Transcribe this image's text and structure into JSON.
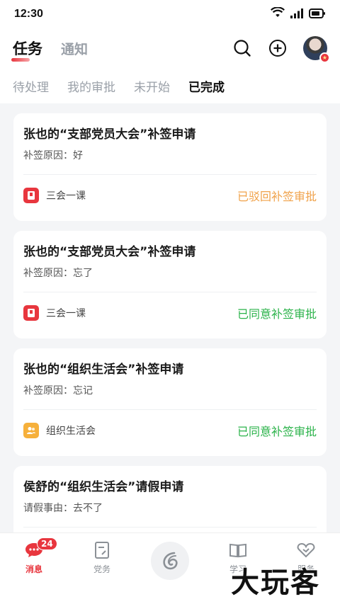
{
  "status_bar": {
    "time": "12:30"
  },
  "header": {
    "tabs": [
      {
        "label": "任务",
        "active": true
      },
      {
        "label": "通知",
        "active": false
      }
    ]
  },
  "sub_tabs": [
    {
      "label": "待处理",
      "active": false
    },
    {
      "label": "我的审批",
      "active": false
    },
    {
      "label": "未开始",
      "active": false
    },
    {
      "label": "已完成",
      "active": true
    }
  ],
  "cards": [
    {
      "title": "张也的“支部党员大会”补签申请",
      "reason": "补签原因：好",
      "category": "三会一课",
      "category_icon": "book-icon",
      "category_color": "#e8363e",
      "status": "已驳回补签审批",
      "status_color": "#f0a24a"
    },
    {
      "title": "张也的“支部党员大会”补签申请",
      "reason": "补签原因：忘了",
      "category": "三会一课",
      "category_icon": "book-icon",
      "category_color": "#e8363e",
      "status": "已同意补签审批",
      "status_color": "#2bb34a"
    },
    {
      "title": "张也的“组织生活会”补签申请",
      "reason": "补签原因：忘记",
      "category": "组织生活会",
      "category_icon": "people-icon",
      "category_color": "#f6b03b",
      "status": "已同意补签审批",
      "status_color": "#2bb34a"
    },
    {
      "title": "侯舒的“组织生活会”请假申请",
      "reason": "请假事由：去不了",
      "category": "",
      "status": ""
    }
  ],
  "bottom_nav": [
    {
      "label": "消息",
      "icon": "chat-bubble-icon",
      "badge": "24",
      "active": true
    },
    {
      "label": "党务",
      "icon": "document-icon",
      "active": false
    },
    {
      "label": "",
      "icon": "logo-swirl-icon",
      "active": false
    },
    {
      "label": "学习",
      "icon": "book-open-icon",
      "active": false
    },
    {
      "label": "服务",
      "icon": "heart-icon",
      "active": false
    }
  ],
  "watermark": "大玩客",
  "colors": {
    "accent": "#e8363e",
    "approved": "#2bb34a",
    "rejected": "#f0a24a"
  }
}
